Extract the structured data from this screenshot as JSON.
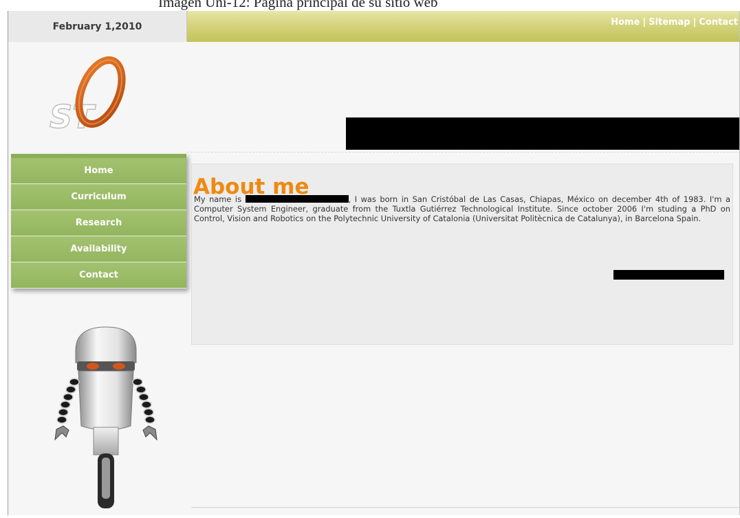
{
  "caption": "Imagen Uni-12: Página principal de su sitio web",
  "header": {
    "date": "February 1,2010",
    "links": {
      "home": "Home",
      "sitemap": "Sitemap",
      "contact": "Contact",
      "separator": "|"
    }
  },
  "logo": {
    "text": "ST"
  },
  "menu": [
    {
      "label": "Home"
    },
    {
      "label": "Curriculum"
    },
    {
      "label": "Research"
    },
    {
      "label": "Availability"
    },
    {
      "label": "Contact"
    }
  ],
  "content": {
    "title": "About me",
    "intro": "My name is",
    "body": ", I was born in San Cristóbal de Las Casas, Chiapas, México on december 4th of 1983. I'm a Computer System Engineer, graduate from the Tuxtla Gutiérrez Technological Institute. Since october 2006 I'm studing a PhD on Control, Vision and Robotics on the Polytechnic University of Catalonia (Universitat Politècnica de Catalunya), in Barcelona Spain."
  },
  "colors": {
    "accent_title": "#ee8a12",
    "menu_green": "#9bbb67",
    "topbar_olive": "#cdcd70",
    "logo_ring": "#d2691e"
  },
  "icons": {
    "logo": "ring-o-logo-icon",
    "mascot": "robot-mascot-icon"
  }
}
